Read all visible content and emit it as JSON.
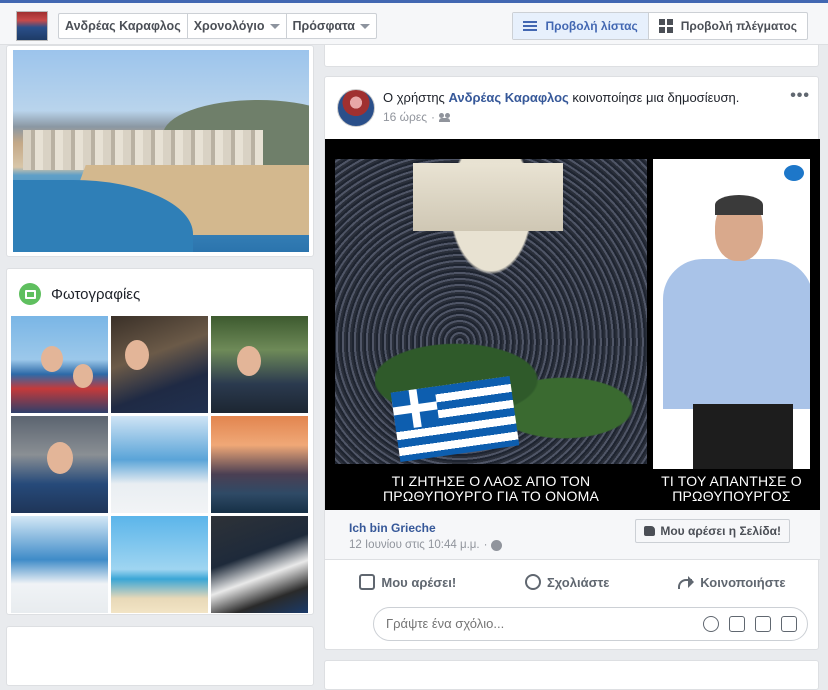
{
  "topbar": {
    "name": "Ανδρέας Καραφλος",
    "nav": [
      "Χρονολόγιο",
      "Πρόσφατα"
    ],
    "list_view": "Προβολή λίστας",
    "grid_view": "Προβολή πλέγματος"
  },
  "sidebar": {
    "photos_title": "Φωτογραφίες"
  },
  "post": {
    "prefix": "Ο χρήστης",
    "author": "Ανδρέας Καραφλος",
    "suffix": "κοινοποίησε μια δημοσίευση.",
    "time": "16 ώρες",
    "image_caption_left": "ΤΙ ΖΗΤΗΣΕ Ο ΛΑΟΣ ΑΠΟ ΤΟΝ ΠΡΩΘΥΠΟΥΡΓΟ ΓΙΑ ΤΟ ΟΝΟΜΑ",
    "image_caption_right": "ΤΙ ΤΟΥ ΑΠΑΝΤΗΣΕ Ο ΠΡΩΘΥΠΟΥΡΓΟΣ",
    "shared_page": "Ich bin Grieche",
    "shared_date": "12 Ιουνίου στις 10:44 μ.μ.",
    "like_page_button": "Μου αρέσει η Σελίδα!",
    "actions": {
      "like": "Μου αρέσει!",
      "comment": "Σχολιάστε",
      "share": "Κοινοποιήστε"
    },
    "comment_placeholder": "Γράψτε ένα σχόλιο..."
  }
}
